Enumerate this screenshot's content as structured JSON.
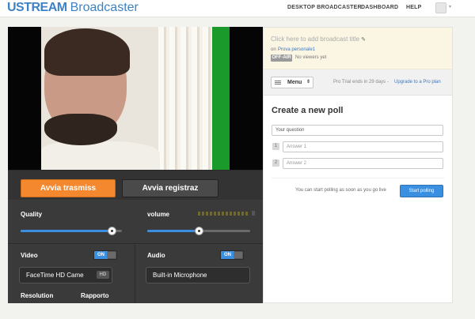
{
  "topbar": {
    "brand": "USTREAM",
    "product": "Broadcaster",
    "nav": [
      "DESKTOP BROADCASTER",
      "DASHBOARD",
      "HELP"
    ],
    "user_caret": "▾"
  },
  "broadcast": {
    "start_button": "Avvia trasmiss",
    "record_button": "Avvia registraz"
  },
  "settings": {
    "quality_label": "Quality",
    "quality_level": 0.9,
    "volume_label": "volume",
    "volume_level": 0.5,
    "video_label": "Video",
    "video_toggle": "ON",
    "camera": "FaceTime HD Came",
    "camera_badge": "HD",
    "audio_label": "Audio",
    "audio_toggle": "ON",
    "microphone": "Built-in Microphone",
    "resolution_label": "Resolution",
    "ratio_label": "Rapporto"
  },
  "info": {
    "add_title": "Click here to add broadcast title",
    "pencil_icon": "✎",
    "on_prefix": "on",
    "channel": "Prova personale1",
    "status": "OFF-AIR",
    "viewers": "No viewers yet"
  },
  "menubar": {
    "menu_label": "Menu",
    "menu_caret": "⇕",
    "trial": "Pro Trial ends in 29 days -",
    "upgrade": "Upgrade to a Pro plan"
  },
  "poll": {
    "title": "Create a new poll",
    "question_placeholder": "Your question",
    "answers": [
      {
        "num": "1",
        "placeholder": "Answer 1"
      },
      {
        "num": "2",
        "placeholder": "Answer 2"
      }
    ],
    "hint": "You can start polling as soon as you go live",
    "start_button": "Start polling"
  },
  "colors": {
    "accent_blue": "#3a8fe0",
    "broadcast_orange": "#f3882e",
    "brand_blue": "#3e82c4"
  }
}
